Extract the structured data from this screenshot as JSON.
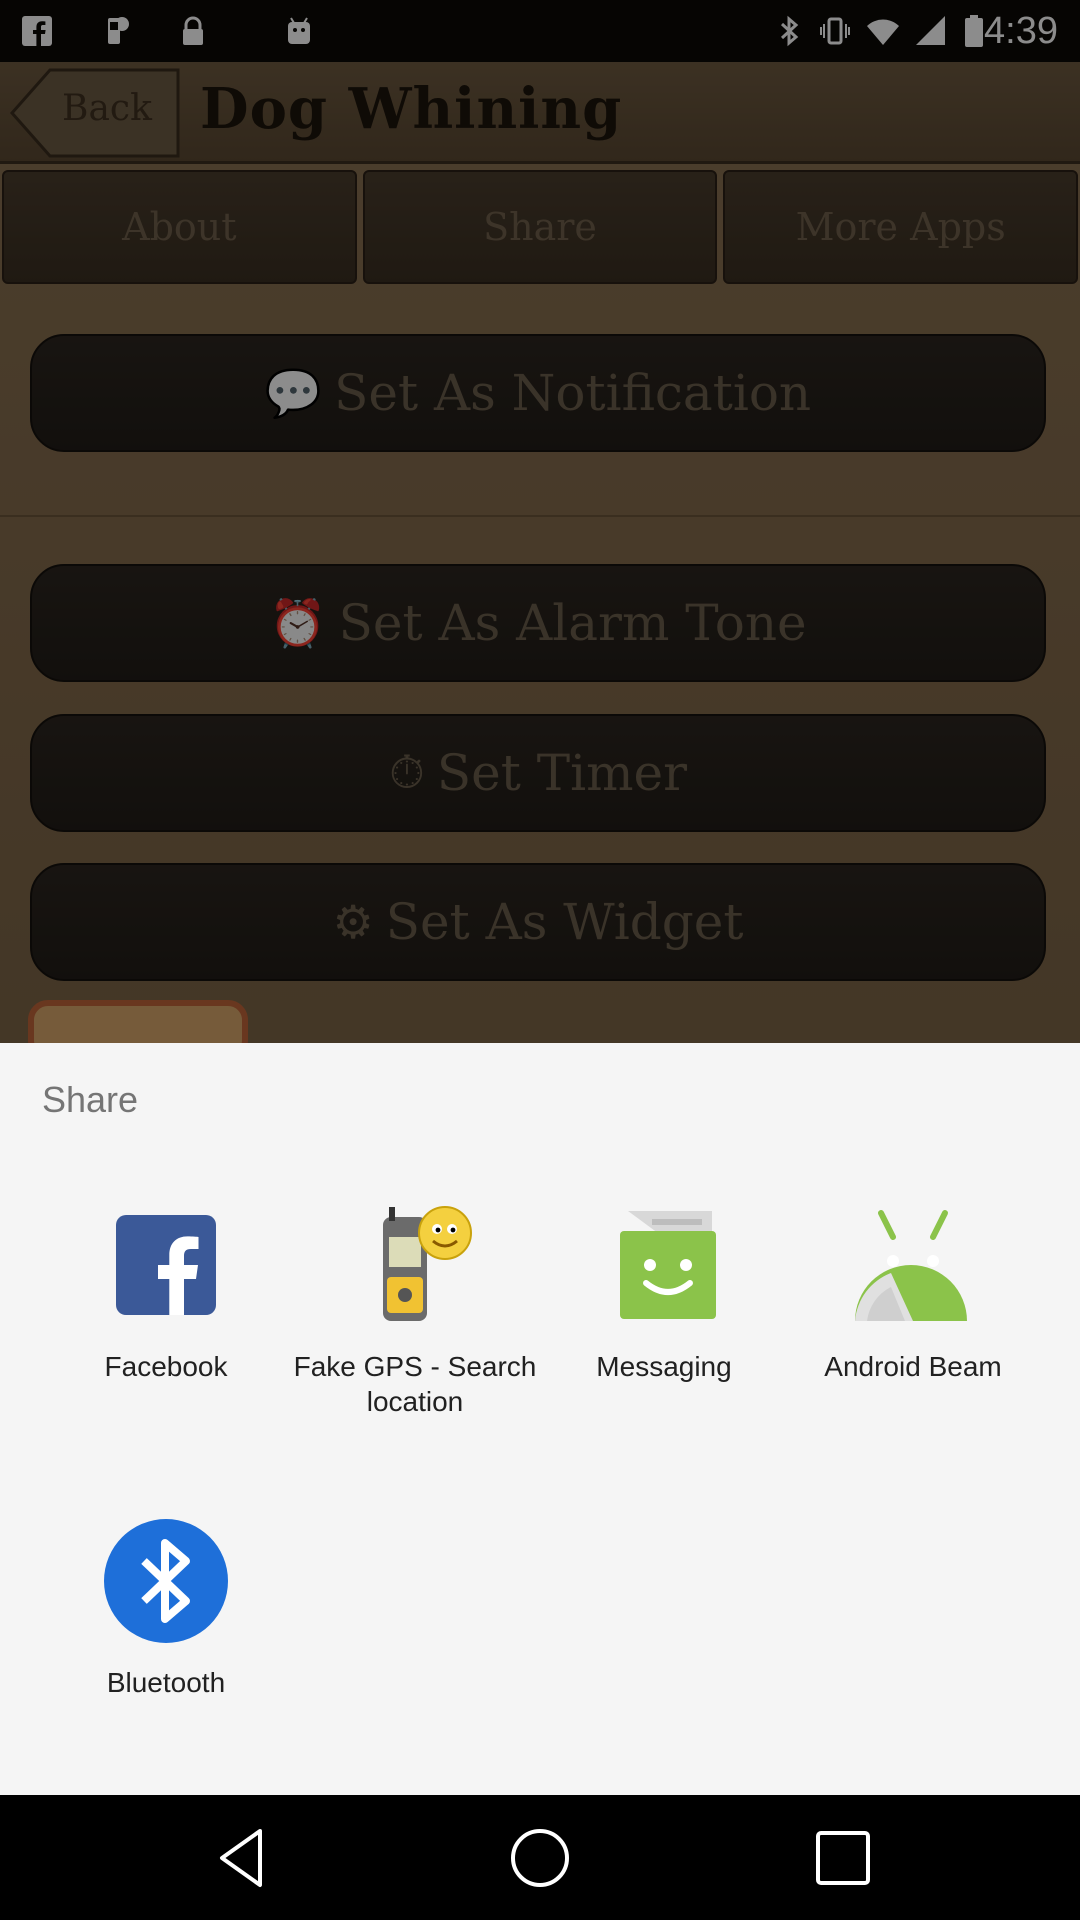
{
  "status_bar": {
    "time": "4:39",
    "icons": [
      "facebook-notification-icon",
      "fake-gps-icon",
      "lock-icon",
      "android-icon",
      "bluetooth-icon",
      "vibrate-icon",
      "wifi-icon",
      "signal-icon",
      "battery-icon"
    ]
  },
  "app": {
    "back_label": "Back",
    "title": "Dog Whining",
    "tabs": [
      {
        "label": "About"
      },
      {
        "label": "Share"
      },
      {
        "label": "More Apps"
      }
    ],
    "actions": [
      {
        "label": "Set As Notification",
        "icon": "speech-bubble-icon"
      },
      {
        "label": "Set As Alarm Tone",
        "icon": "alarm-clock-icon"
      },
      {
        "label": "Set Timer",
        "icon": "stopwatch-icon"
      },
      {
        "label": "Set As Widget",
        "icon": "gear-icon"
      }
    ]
  },
  "share_sheet": {
    "title": "Share",
    "targets": [
      {
        "label": "Facebook",
        "icon": "facebook-icon"
      },
      {
        "label": "Fake GPS - Search location",
        "icon": "fake-gps-icon"
      },
      {
        "label": "Messaging",
        "icon": "messaging-icon"
      },
      {
        "label": "Android Beam",
        "icon": "android-beam-icon"
      },
      {
        "label": "Bluetooth",
        "icon": "bluetooth-icon"
      }
    ]
  },
  "colors": {
    "facebook_blue": "#3b5998",
    "messaging_green": "#8bc34a",
    "android_green": "#8bc34a",
    "bluetooth_blue": "#1e6fd9",
    "sheet_background": "#f5f5f5"
  }
}
